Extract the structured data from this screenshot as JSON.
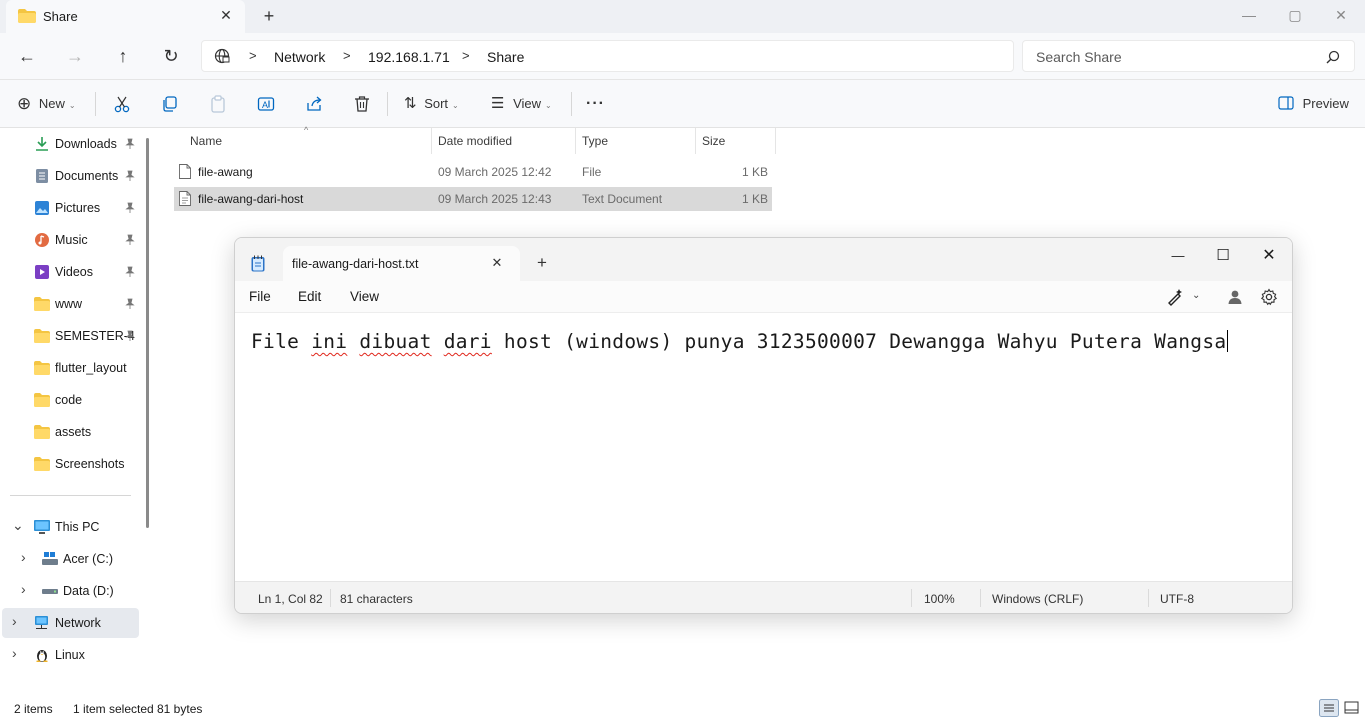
{
  "window": {
    "tab_title": "Share",
    "tab_close": "✕",
    "new_tab": "+",
    "controls": {
      "minimize": "—",
      "maximize": "▢",
      "close": "✕"
    }
  },
  "navigation": {
    "back": "←",
    "forward": "→",
    "up": "↑",
    "refresh": "↻",
    "breadcrumb": [
      "Network",
      "192.168.1.71",
      "Share"
    ],
    "separator": ">",
    "search_placeholder": "Search Share"
  },
  "toolbar": {
    "new_label": "New",
    "sort_label": "Sort",
    "view_label": "View",
    "more_label": "···",
    "preview_label": "Preview",
    "caret": "⌄"
  },
  "sidebar": {
    "quick_access": [
      {
        "label": "Downloads",
        "icon": "download-icon"
      },
      {
        "label": "Documents",
        "icon": "documents-icon"
      },
      {
        "label": "Pictures",
        "icon": "pictures-icon"
      },
      {
        "label": "Music",
        "icon": "music-icon"
      },
      {
        "label": "Videos",
        "icon": "videos-icon"
      },
      {
        "label": "www",
        "icon": "folder-icon"
      },
      {
        "label": "SEMESTER-4",
        "icon": "folder-icon"
      },
      {
        "label": "flutter_layout",
        "icon": "folder-icon"
      },
      {
        "label": "code",
        "icon": "folder-icon"
      },
      {
        "label": "assets",
        "icon": "folder-icon"
      },
      {
        "label": "Screenshots",
        "icon": "folder-icon"
      }
    ],
    "tree": [
      {
        "label": "This PC",
        "chevron": "⌄",
        "icon": "pc-icon"
      },
      {
        "label": "Acer (C:)",
        "chevron": "›",
        "icon": "drive-icon"
      },
      {
        "label": "Data (D:)",
        "chevron": "›",
        "icon": "drive-icon"
      },
      {
        "label": "Network",
        "chevron": "›",
        "icon": "network-icon",
        "selected": true
      },
      {
        "label": "Linux",
        "chevron": "›",
        "icon": "linux-icon"
      }
    ]
  },
  "file_list": {
    "columns": {
      "name": "Name",
      "date": "Date modified",
      "type": "Type",
      "size": "Size"
    },
    "sort_indicator": "^",
    "rows": [
      {
        "name": "file-awang",
        "date": "09 March 2025 12:42",
        "type": "File",
        "size": "1 KB",
        "selected": false
      },
      {
        "name": "file-awang-dari-host",
        "date": "09 March 2025 12:43",
        "type": "Text Document",
        "size": "1 KB",
        "selected": true
      }
    ]
  },
  "status_bar": {
    "items_count": "2 items",
    "selection": "1 item selected",
    "size": "81 bytes"
  },
  "notepad": {
    "tab_title": "file-awang-dari-host.txt",
    "tab_close": "✕",
    "new_tab": "+",
    "controls": {
      "minimize": "—",
      "maximize": "☐",
      "close": "✕"
    },
    "menus": [
      "File",
      "Edit",
      "View"
    ],
    "content_words": [
      "File",
      "ini",
      "dibuat",
      "dari",
      "host",
      "(windows)",
      "punya",
      "3123500007",
      "Dewangga",
      "Wahyu",
      "Putera",
      "Wangsa"
    ],
    "misspelled": [
      "ini",
      "dibuat",
      "dari"
    ],
    "status": {
      "position": "Ln 1, Col 82",
      "characters": "81 characters",
      "zoom": "100%",
      "line_ending": "Windows (CRLF)",
      "encoding": "UTF-8"
    }
  },
  "colors": {
    "accent": "#0067c0",
    "folder": "#f4c542",
    "selected_row": "#d9d9d9",
    "spellcheck": "#e0261b"
  }
}
